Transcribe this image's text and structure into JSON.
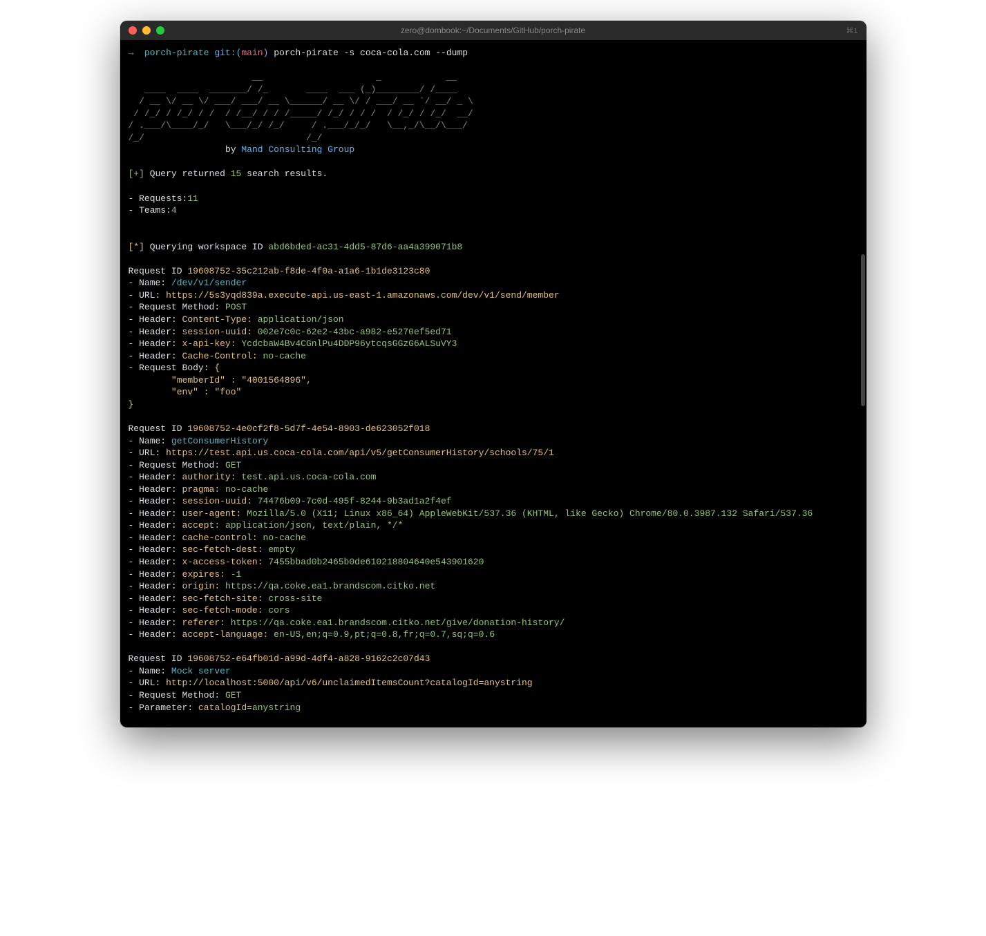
{
  "window": {
    "title": "zero@dombook:~/Documents/GitHub/porch-pirate",
    "shortcut": "⌘1"
  },
  "prompt": {
    "arrow": "→",
    "path": "porch-pirate",
    "git_prefix": "git:(",
    "branch": "main",
    "git_suffix": ")",
    "command": "porch-pirate -s coca-cola.com --dump"
  },
  "ascii": {
    "l1": "                       __                     _            __      ",
    "l2": "   ____  ____  _______/ /_       ____  ___ (_)________/ /____  ",
    "l3": "  / __ \\/ __ \\/ ___/ ___/ __ \\______/ __ \\/ / ___/ __ `/ __/ _ \\ ",
    "l4": " / /_/ / /_/ / /  / /__/ / / /_____/ /_/ / / /  / /_/ / /_/  __/ ",
    "l5": "/ .___/\\____/_/   \\___/_/ /_/     / .___/_/_/   \\__,_/\\__/\\___/ ",
    "l6": "/_/                              /_/                               "
  },
  "credit": {
    "by": "by ",
    "group": "Mand Consulting Group"
  },
  "summary": {
    "plus": "[+]",
    "query_text_a": " Query returned ",
    "count": "15",
    "query_text_b": " search results.",
    "requests_label": "- Requests:",
    "requests_count": "11",
    "teams_label": "- Teams:",
    "teams_count": "4"
  },
  "workspace": {
    "star": "[*]",
    "text": " Querying workspace ID ",
    "id": "abd6bded-ac31-4dd5-87d6-aa4a399071b8"
  },
  "req1": {
    "id_label": "Request ID ",
    "id": "19608752-35c212ab-f8de-4f0a-a1a6-1b1de3123c80",
    "name_label": "- Name: ",
    "name": "/dev/v1/sender",
    "url_label": "- URL: ",
    "url": "https://5s3yqd839a.execute-api.us-east-1.amazonaws.com/dev/v1/send/member",
    "method_label": "- Request Method: ",
    "method": "POST",
    "h_label": "- Header: ",
    "h1k": "Content-Type: ",
    "h1v": "application/json",
    "h2k": "session-uuid: ",
    "h2v": "002e7c0c-62e2-43bc-a982-e5270ef5ed71",
    "h3k": "x-api-key: ",
    "h3v": "YcdcbaW4Bv4CGnlPu4DDP96ytcqsGGzG6ALSuVY3",
    "h4k": "Cache-Control: ",
    "h4v": "no-cache",
    "body_label": "- Request Body: ",
    "body_open": "{",
    "body_l1": "        \"memberId\" : \"4001564896\",",
    "body_l2": "        \"env\" : \"foo\"",
    "body_close": "}"
  },
  "req2": {
    "id_label": "Request ID ",
    "id": "19608752-4e0cf2f8-5d7f-4e54-8903-de623052f018",
    "name_label": "- Name: ",
    "name": "getConsumerHistory",
    "url_label": "- URL: ",
    "url": "https://test.api.us.coca-cola.com/api/v5/getConsumerHistory/schools/75/1",
    "method_label": "- Request Method: ",
    "method": "GET",
    "h_label": "- Header: ",
    "h1k": "authority: ",
    "h1v": "test.api.us.coca-cola.com",
    "h2k": "pragma: ",
    "h2v": "no-cache",
    "h3k": "session-uuid: ",
    "h3v": "74476b09-7c0d-495f-8244-9b3ad1a2f4ef",
    "h4k": "user-agent: ",
    "h4v": "Mozilla/5.0 (X11; Linux x86_64) AppleWebKit/537.36 (KHTML, like Gecko) Chrome/80.0.3987.132 Safari/537.36",
    "h5k": "accept: ",
    "h5v": "application/json, text/plain, */*",
    "h6k": "cache-control: ",
    "h6v": "no-cache",
    "h7k": "sec-fetch-dest: ",
    "h7v": "empty",
    "h8k": "x-access-token: ",
    "h8v": "7455bbad0b2465b0de610218804640e543901620",
    "h9k": "expires: ",
    "h9v": "-1",
    "h10k": "origin: ",
    "h10v": "https://qa.coke.ea1.brandscom.citko.net",
    "h11k": "sec-fetch-site: ",
    "h11v": "cross-site",
    "h12k": "sec-fetch-mode: ",
    "h12v": "cors",
    "h13k": "referer: ",
    "h13v": "https://qa.coke.ea1.brandscom.citko.net/give/donation-history/",
    "h14k": "accept-language: ",
    "h14v": "en-US,en;q=0.9,pt;q=0.8,fr;q=0.7,sq;q=0.6"
  },
  "req3": {
    "id_label": "Request ID ",
    "id": "19608752-e64fb01d-a99d-4df4-a828-9162c2c07d43",
    "name_label": "- Name: ",
    "name": "Mock server",
    "url_label": "- URL: ",
    "url": "http://localhost:5000/api/v6/unclaimedItemsCount?catalogId=anystring",
    "method_label": "- Request Method: ",
    "method": "GET",
    "param_label": "- Parameter: ",
    "param_k": "catalogId=",
    "param_v": "anystring"
  }
}
